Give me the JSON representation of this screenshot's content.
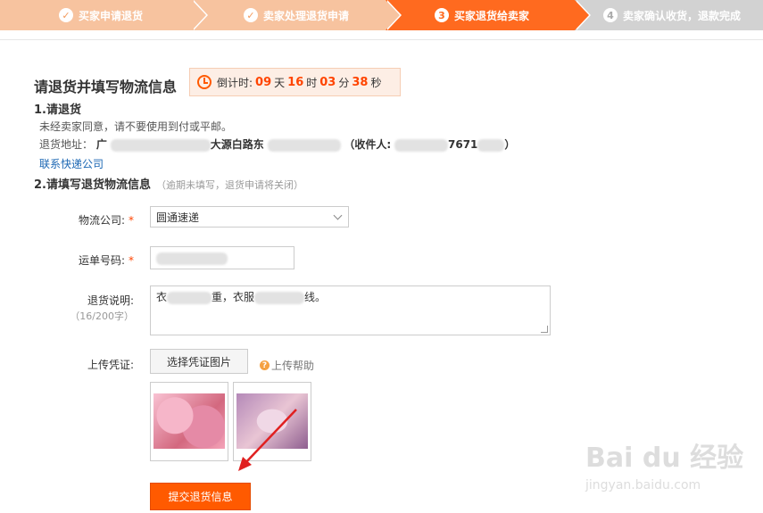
{
  "steps": [
    {
      "label": "买家申请退货",
      "icon": "check",
      "state": "done"
    },
    {
      "label": "卖家处理退货申请",
      "icon": "check",
      "state": "done"
    },
    {
      "label": "买家退货给卖家",
      "number": "3",
      "state": "active"
    },
    {
      "label": "卖家确认收货，退款完成",
      "number": "4",
      "state": "todo"
    }
  ],
  "title": "请退货并填写物流信息",
  "countdown": {
    "label": "倒计时:",
    "days": "09",
    "days_unit": "天",
    "hours": "16",
    "hours_unit": "时",
    "minutes": "03",
    "minutes_unit": "分",
    "seconds": "38",
    "seconds_unit": "秒"
  },
  "section1": {
    "title": "1.请退货",
    "note": "未经卖家同意，请不要使用到付或平邮。",
    "address_label": "退货地址：",
    "address_prefix": "广",
    "address_mid": "大源白路东",
    "receiver_label": "（收件人:",
    "receiver_phone_fragment": "7671",
    "receiver_close": "）",
    "contact_link": "联系快递公司"
  },
  "section2": {
    "title": "2.请填写退货物流信息",
    "hint": "（逾期未填写，退货申请将关闭）"
  },
  "form": {
    "logistics_label": "物流公司:",
    "logistics_value": "圆通速递",
    "tracking_label": "运单号码:",
    "desc_label": "退货说明:",
    "desc_count": "（16/200字）",
    "desc_value_a": "衣",
    "desc_value_b": "重，衣服",
    "desc_value_c": "线。",
    "upload_label": "上传凭证:",
    "upload_button": "选择凭证图片",
    "upload_help": "上传帮助",
    "submit": "提交退货信息"
  },
  "watermark": {
    "text": "Bai du 经验",
    "url": "jingyan.baidu.com"
  },
  "colors": {
    "active": "#ff6a1f",
    "done": "#f7c39f",
    "todo": "#d2d2d2",
    "accent": "#ff5a00"
  }
}
